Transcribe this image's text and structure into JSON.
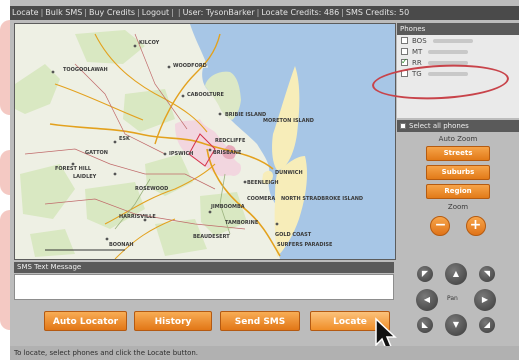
{
  "topbar": {
    "nav": [
      "Locate",
      "Bulk SMS",
      "Buy Credits",
      "Logout"
    ],
    "user_text": "User: TysonBarker",
    "locate_credits": "Locate Credits: 486",
    "sms_credits": "SMS Credits: 50"
  },
  "map": {
    "labels": [
      "TOOGOOLAWAH",
      "KILCOY",
      "WOODFORD",
      "CABOOLTURE",
      "BRIBIE ISLAND",
      "ESK",
      "REDCLIFFE",
      "MORETON ISLAND",
      "NORTH STRADBROKE ISLAND",
      "IPSWICH",
      "BRISBANE",
      "FOREST HILL",
      "GATTON",
      "LAIDLEY",
      "BEENLEIGH",
      "JIMBOOMBA",
      "COOMERA",
      "BEAUDESERT",
      "GOLD COAST",
      "BOONAH",
      "HARRISVILLE",
      "ROSEWOOD",
      "TAMBORINE",
      "SURFERS PARADISE",
      "DUNWICH"
    ]
  },
  "phones": {
    "title": "Phones",
    "items": [
      {
        "label": "BOS",
        "checked": false
      },
      {
        "label": "MT",
        "checked": false
      },
      {
        "label": "RR",
        "checked": true
      },
      {
        "label": "TG",
        "checked": false
      }
    ],
    "select_all": "Select all phones"
  },
  "autozoom": {
    "title": "Auto Zoom",
    "buttons": [
      "Streets",
      "Suburbs",
      "Region"
    ],
    "zoom_title": "Zoom",
    "zoom_out": "−",
    "zoom_in": "+"
  },
  "pad": {
    "pan_label": "Pan"
  },
  "sms": {
    "header": "SMS Text Message",
    "value": ""
  },
  "actions": {
    "auto_locator": "Auto Locator",
    "history": "History",
    "send_sms": "Send SMS",
    "locate": "Locate"
  },
  "status": "To locate, select phones and click the Locate button."
}
